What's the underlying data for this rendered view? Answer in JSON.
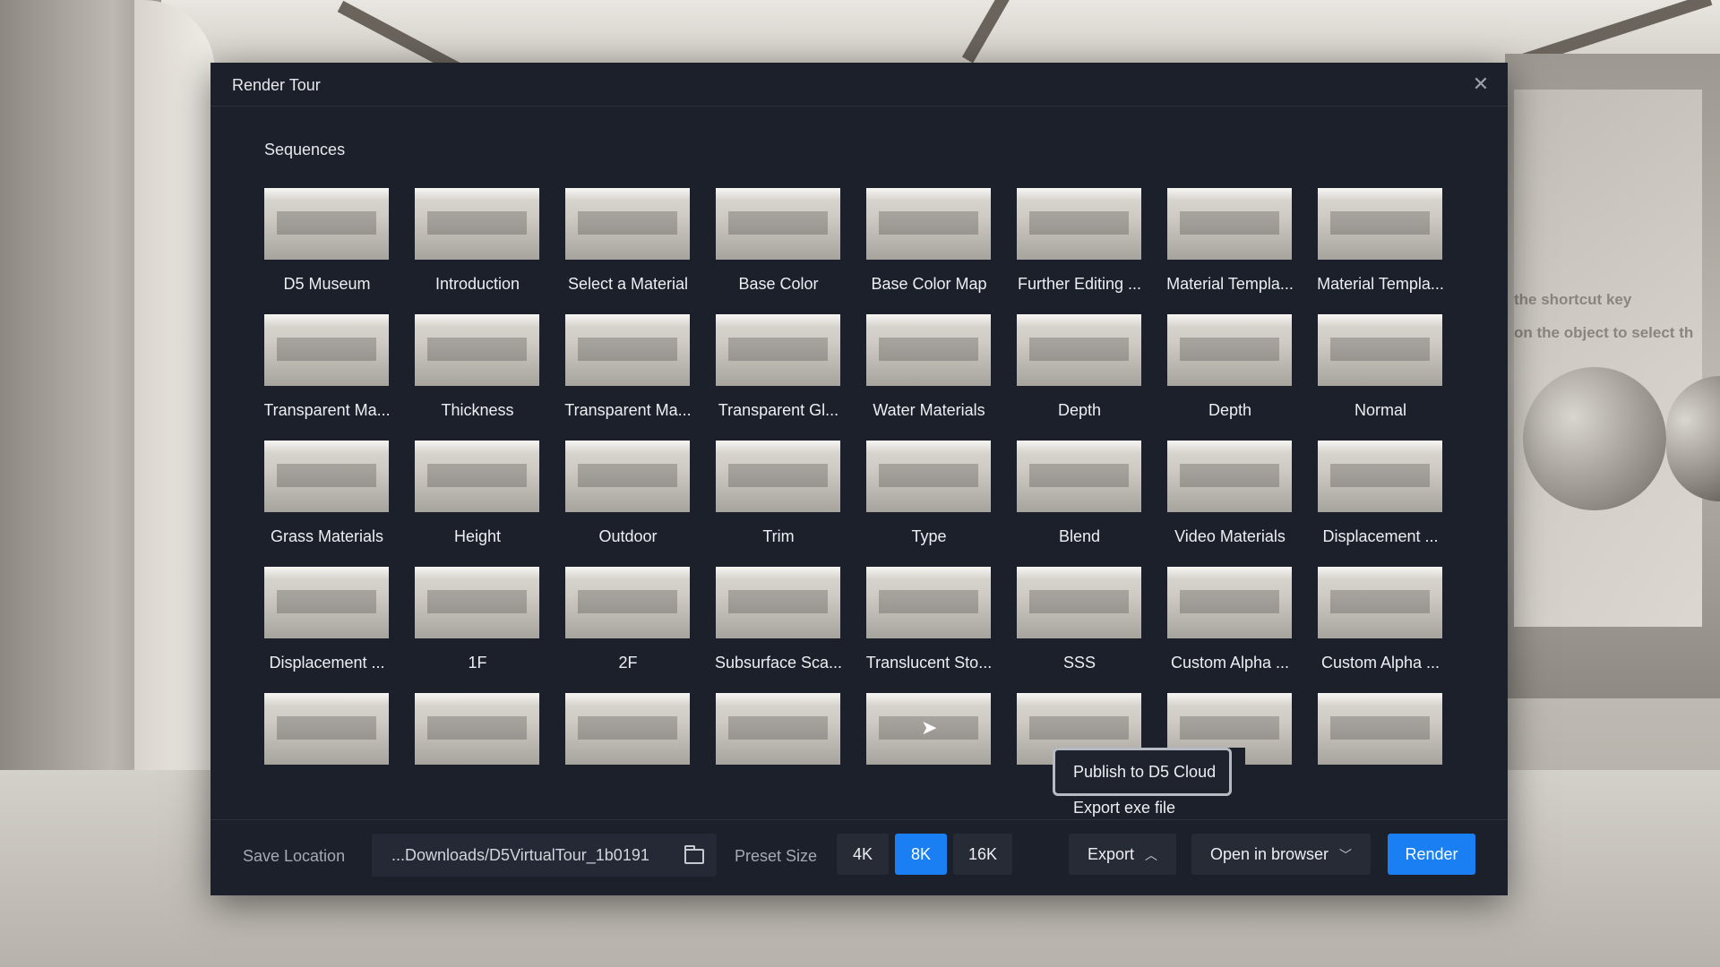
{
  "background": {
    "text_line1": "the shortcut key",
    "text_line2": "on the object to select th"
  },
  "dialog": {
    "title": "Render Tour",
    "close_icon": "close-icon",
    "sequences_label": "Sequences"
  },
  "sequences": [
    {
      "label": "D5 Museum"
    },
    {
      "label": "Introduction"
    },
    {
      "label": "Select a Material"
    },
    {
      "label": "Base Color"
    },
    {
      "label": "Base Color Map"
    },
    {
      "label": "Further Editing ..."
    },
    {
      "label": "Material Templa..."
    },
    {
      "label": "Material Templa..."
    },
    {
      "label": "Transparent Ma..."
    },
    {
      "label": "Thickness"
    },
    {
      "label": "Transparent Ma..."
    },
    {
      "label": "Transparent Gl..."
    },
    {
      "label": "Water Materials"
    },
    {
      "label": "Depth"
    },
    {
      "label": "Depth"
    },
    {
      "label": "Normal"
    },
    {
      "label": "Grass Materials"
    },
    {
      "label": "Height"
    },
    {
      "label": "Outdoor"
    },
    {
      "label": "Trim"
    },
    {
      "label": "Type"
    },
    {
      "label": "Blend"
    },
    {
      "label": "Video Materials"
    },
    {
      "label": "Displacement ..."
    },
    {
      "label": "Displacement ..."
    },
    {
      "label": "1F"
    },
    {
      "label": "2F"
    },
    {
      "label": "Subsurface Sca..."
    },
    {
      "label": "Translucent Sto..."
    },
    {
      "label": "SSS"
    },
    {
      "label": "Custom Alpha ..."
    },
    {
      "label": "Custom Alpha ..."
    },
    {
      "label": ""
    },
    {
      "label": ""
    },
    {
      "label": ""
    },
    {
      "label": ""
    },
    {
      "label": ""
    },
    {
      "label": ""
    },
    {
      "label": ""
    },
    {
      "label": ""
    }
  ],
  "export_menu": {
    "publish": "Publish to D5 Cloud",
    "export_exe": "Export exe file"
  },
  "footer": {
    "save_location_label": "Save Location",
    "save_path": "...Downloads/D5VirtualTour_1b0191",
    "folder_icon": "folder-icon",
    "preset_size_label": "Preset Size",
    "sizes": [
      "4K",
      "8K",
      "16K"
    ],
    "selected_size": "8K",
    "export_label": "Export",
    "open_label": "Open in browser",
    "render_label": "Render"
  },
  "colors": {
    "accent": "#1a7ff2",
    "dialog_bg": "#1c202a"
  }
}
